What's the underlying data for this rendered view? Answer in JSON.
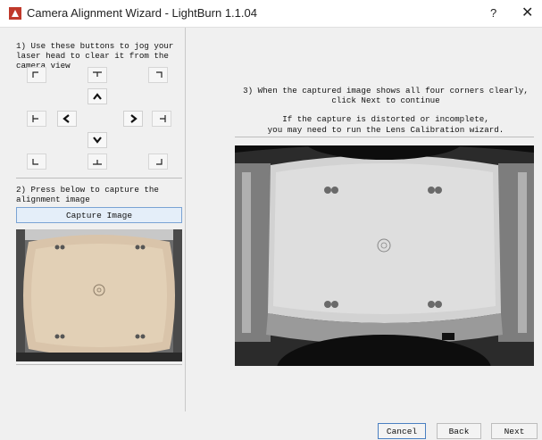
{
  "window": {
    "title": "Camera Alignment Wizard - LightBurn 1.1.04",
    "help_label": "?",
    "close_label": "✕"
  },
  "step1": {
    "text": "1) Use these buttons to jog your laser head to clear it from the camera view"
  },
  "jog": {
    "corner_buttons": [
      "top-left",
      "top-center",
      "top-right",
      "middle-left",
      "middle-right",
      "bottom-left",
      "bottom-center",
      "bottom-right"
    ],
    "arrow_buttons": [
      "up",
      "left",
      "right",
      "down"
    ]
  },
  "step2": {
    "text": "2) Press below to capture the alignment image",
    "capture_label": "Capture Image"
  },
  "step3": {
    "text": "3) When the captured image shows all four corners clearly, click Next to continue",
    "note_line1": "If the capture is distorted or incomplete,",
    "note_line2": "you may need to run the Lens Calibration wizard."
  },
  "footer": {
    "cancel_label": "Cancel",
    "back_label": "Back",
    "next_label": "Next"
  },
  "colors": {
    "brand": "#c0392b",
    "focus_border": "#4a7fc1"
  }
}
